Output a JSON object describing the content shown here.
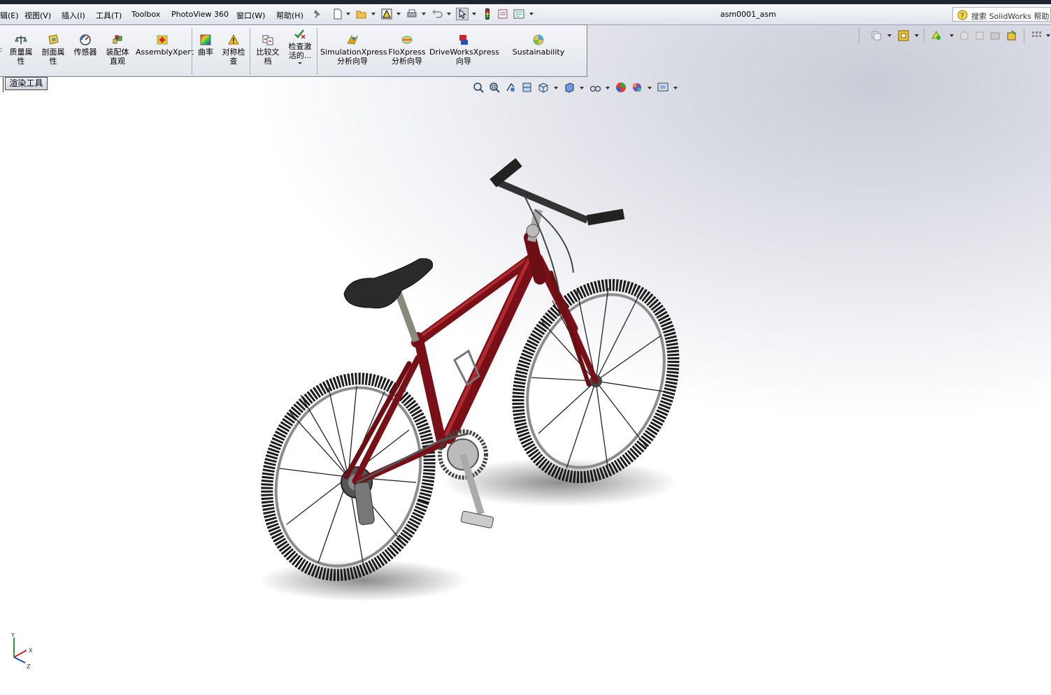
{
  "window": {
    "title": "asm0001_asm",
    "search_placeholder": "搜索 SolidWorks 帮助"
  },
  "menu": [
    "辑(E)",
    "视图(V)",
    "插入(I)",
    "工具(T)",
    "Toolbox",
    "PhotoView 360",
    "窗口(W)",
    "帮助(H)"
  ],
  "command_manager": {
    "items": [
      {
        "label": "质量属\n性",
        "icon": "mass-properties-icon"
      },
      {
        "label": "剖面属\n性",
        "icon": "section-properties-icon"
      },
      {
        "label": "传感器",
        "icon": "sensor-icon"
      },
      {
        "label": "装配体\n直观",
        "icon": "assembly-visualization-icon"
      },
      {
        "label": "AssemblyXpert",
        "icon": "assemblyxpert-icon"
      },
      {
        "label": "曲率",
        "icon": "curvature-icon"
      },
      {
        "label": "对称检\n查",
        "icon": "symmetry-check-icon"
      },
      {
        "label": "比较文\n档",
        "icon": "compare-documents-icon"
      },
      {
        "label": "检查激\n活的...",
        "icon": "check-active-icon"
      },
      {
        "label": "SimulationXpress\n分析向导",
        "icon": "simulationxpress-icon"
      },
      {
        "label": "FloXpress\n分析向导",
        "icon": "floxpress-icon"
      },
      {
        "label": "DriveWorksXpress\n向导",
        "icon": "driveworksxpress-icon"
      },
      {
        "label": "Sustainability",
        "icon": "sustainability-icon"
      }
    ],
    "active_tab": "渲染工具"
  },
  "colors": {
    "frame": "#7a1017",
    "frame_highlight": "#b02a30",
    "tire": "#1b1b1b",
    "rim": "#8c8c8c",
    "accent_blue": "#1f5fbf"
  },
  "triad_axes": [
    "Y",
    "X",
    "Z"
  ]
}
